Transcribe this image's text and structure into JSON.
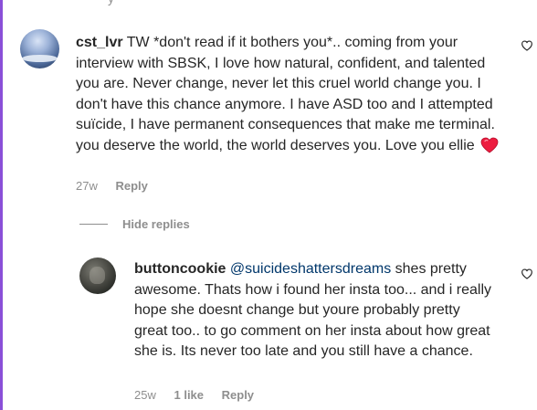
{
  "comments": [
    {
      "username": "cst_lvr",
      "text": "TW *don't read if it bothers you*.. coming from your interview with SBSK, I love how natural, confident, and talented you are. Never change, never let this cruel world change you. I don't have this chance anymore. I have ASD too and I attempted suïcide, I have permanent consequences that make me terminal. you deserve the world, the world deserves you. Love you ellie",
      "emoji": "heart",
      "time": "27w",
      "reply_label": "Reply"
    },
    {
      "username": "buttoncookie",
      "mention": "@suicideshattersdreams",
      "text": "shes pretty awesome. Thats how i found her insta too... and i really hope she doesnt change but youre probably pretty great too.. to go comment on her insta about how great she is. Its never too late and you still have a chance.",
      "time": "25w",
      "likes": "1 like",
      "reply_label": "Reply"
    }
  ],
  "hide_replies_label": "Hide replies",
  "colors": {
    "accent": "#8a4fd8",
    "mention": "#00376b",
    "meta": "#8e8e8e",
    "heart": "#ed1c3f"
  },
  "icons": {
    "like": "heart-outline-icon",
    "emoji": "red-heart-emoji"
  }
}
